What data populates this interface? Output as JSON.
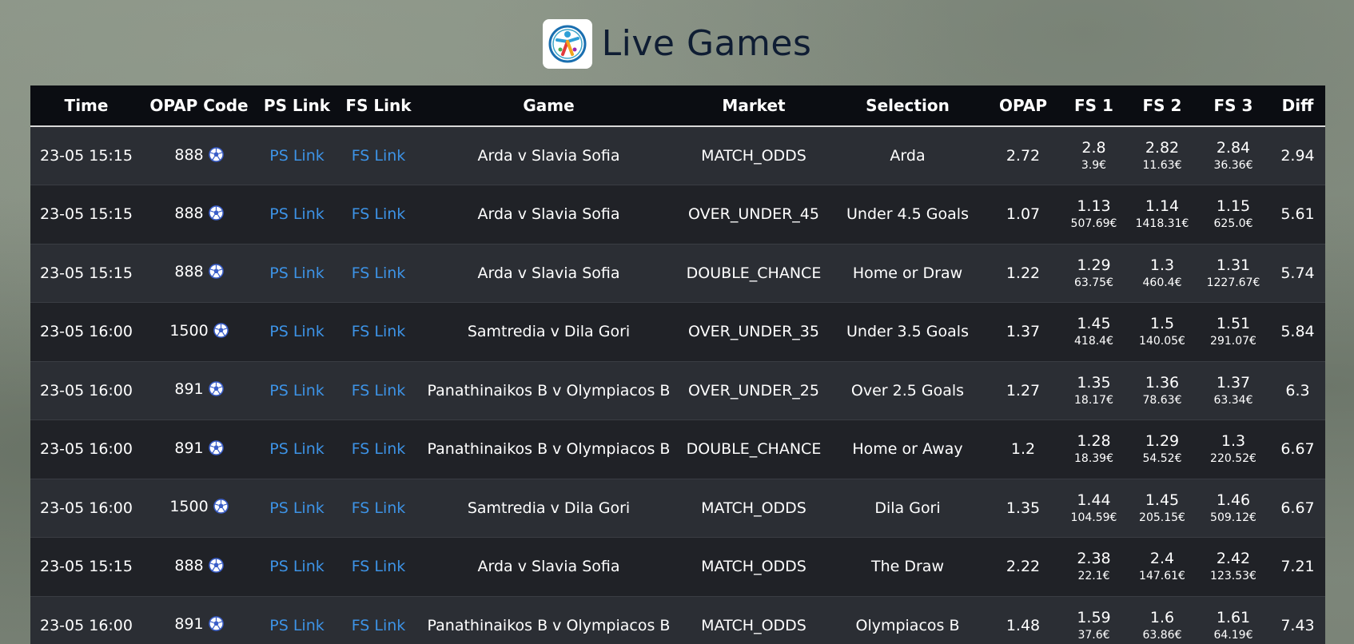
{
  "page": {
    "title": "Live Games",
    "logo": "sports-figure-logo"
  },
  "table": {
    "headers": {
      "time": "Time",
      "opap_code": "OPAP Code",
      "ps_link": "PS Link",
      "fs_link": "FS Link",
      "game": "Game",
      "market": "Market",
      "selection": "Selection",
      "opap": "OPAP",
      "fs1": "FS 1",
      "fs2": "FS 2",
      "fs3": "FS 3",
      "diff": "Diff"
    },
    "rows": [
      {
        "time": "23-05 15:15",
        "code": "888",
        "ps": "PS Link",
        "fs": "FS Link",
        "game": "Arda v Slavia Sofia",
        "market": "MATCH_ODDS",
        "selection": "Arda",
        "opap": "2.72",
        "fs1": {
          "odds": "2.8",
          "amount": "3.9€"
        },
        "fs2": {
          "odds": "2.82",
          "amount": "11.63€"
        },
        "fs3": {
          "odds": "2.84",
          "amount": "36.36€"
        },
        "diff": "2.94"
      },
      {
        "time": "23-05 15:15",
        "code": "888",
        "ps": "PS Link",
        "fs": "FS Link",
        "game": "Arda v Slavia Sofia",
        "market": "OVER_UNDER_45",
        "selection": "Under 4.5 Goals",
        "opap": "1.07",
        "fs1": {
          "odds": "1.13",
          "amount": "507.69€"
        },
        "fs2": {
          "odds": "1.14",
          "amount": "1418.31€"
        },
        "fs3": {
          "odds": "1.15",
          "amount": "625.0€"
        },
        "diff": "5.61"
      },
      {
        "time": "23-05 15:15",
        "code": "888",
        "ps": "PS Link",
        "fs": "FS Link",
        "game": "Arda v Slavia Sofia",
        "market": "DOUBLE_CHANCE",
        "selection": "Home or Draw",
        "opap": "1.22",
        "fs1": {
          "odds": "1.29",
          "amount": "63.75€"
        },
        "fs2": {
          "odds": "1.3",
          "amount": "460.4€"
        },
        "fs3": {
          "odds": "1.31",
          "amount": "1227.67€"
        },
        "diff": "5.74"
      },
      {
        "time": "23-05 16:00",
        "code": "1500",
        "ps": "PS Link",
        "fs": "FS Link",
        "game": "Samtredia v Dila Gori",
        "market": "OVER_UNDER_35",
        "selection": "Under 3.5 Goals",
        "opap": "1.37",
        "fs1": {
          "odds": "1.45",
          "amount": "418.4€"
        },
        "fs2": {
          "odds": "1.5",
          "amount": "140.05€"
        },
        "fs3": {
          "odds": "1.51",
          "amount": "291.07€"
        },
        "diff": "5.84"
      },
      {
        "time": "23-05 16:00",
        "code": "891",
        "ps": "PS Link",
        "fs": "FS Link",
        "game": "Panathinaikos B v Olympiacos B",
        "market": "OVER_UNDER_25",
        "selection": "Over 2.5 Goals",
        "opap": "1.27",
        "fs1": {
          "odds": "1.35",
          "amount": "18.17€"
        },
        "fs2": {
          "odds": "1.36",
          "amount": "78.63€"
        },
        "fs3": {
          "odds": "1.37",
          "amount": "63.34€"
        },
        "diff": "6.3"
      },
      {
        "time": "23-05 16:00",
        "code": "891",
        "ps": "PS Link",
        "fs": "FS Link",
        "game": "Panathinaikos B v Olympiacos B",
        "market": "DOUBLE_CHANCE",
        "selection": "Home or Away",
        "opap": "1.2",
        "fs1": {
          "odds": "1.28",
          "amount": "18.39€"
        },
        "fs2": {
          "odds": "1.29",
          "amount": "54.52€"
        },
        "fs3": {
          "odds": "1.3",
          "amount": "220.52€"
        },
        "diff": "6.67"
      },
      {
        "time": "23-05 16:00",
        "code": "1500",
        "ps": "PS Link",
        "fs": "FS Link",
        "game": "Samtredia v Dila Gori",
        "market": "MATCH_ODDS",
        "selection": "Dila Gori",
        "opap": "1.35",
        "fs1": {
          "odds": "1.44",
          "amount": "104.59€"
        },
        "fs2": {
          "odds": "1.45",
          "amount": "205.15€"
        },
        "fs3": {
          "odds": "1.46",
          "amount": "509.12€"
        },
        "diff": "6.67"
      },
      {
        "time": "23-05 15:15",
        "code": "888",
        "ps": "PS Link",
        "fs": "FS Link",
        "game": "Arda v Slavia Sofia",
        "market": "MATCH_ODDS",
        "selection": "The Draw",
        "opap": "2.22",
        "fs1": {
          "odds": "2.38",
          "amount": "22.1€"
        },
        "fs2": {
          "odds": "2.4",
          "amount": "147.61€"
        },
        "fs3": {
          "odds": "2.42",
          "amount": "123.53€"
        },
        "diff": "7.21"
      },
      {
        "time": "23-05 16:00",
        "code": "891",
        "ps": "PS Link",
        "fs": "FS Link",
        "game": "Panathinaikos B v Olympiacos B",
        "market": "MATCH_ODDS",
        "selection": "Olympiacos B",
        "opap": "1.48",
        "fs1": {
          "odds": "1.59",
          "amount": "37.6€"
        },
        "fs2": {
          "odds": "1.6",
          "amount": "63.86€"
        },
        "fs3": {
          "odds": "1.61",
          "amount": "64.19€"
        },
        "diff": "7.43"
      }
    ],
    "sport_icon": "soccer-ball-icon"
  },
  "colors": {
    "header_bg": "#0b0d12",
    "row_odd": "#2b2e34",
    "row_even": "#202227",
    "link": "#3d93e6",
    "title": "#0f1d33"
  }
}
